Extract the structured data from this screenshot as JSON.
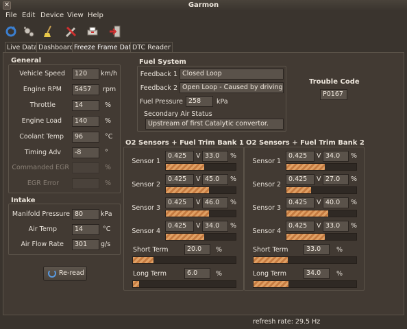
{
  "window": {
    "title": "Garmon",
    "close_icon": "close-icon"
  },
  "menu": [
    "File",
    "Edit",
    "Device",
    "View",
    "Help"
  ],
  "toolbar": [
    "refresh-icon",
    "device-settings-icon",
    "clear-codes-icon",
    "tools-icon",
    "print-icon",
    "exit-icon"
  ],
  "tabs": [
    "Live Data",
    "Dashboard",
    "Freeze Frame Data",
    "DTC Reader"
  ],
  "general": {
    "title": "General",
    "rows": [
      {
        "label": "Vehicle Speed",
        "value": "120",
        "unit": "km/h",
        "enabled": true
      },
      {
        "label": "Engine RPM",
        "value": "5457",
        "unit": "rpm",
        "enabled": true
      },
      {
        "label": "Throttle",
        "value": "14",
        "unit": "%",
        "enabled": true
      },
      {
        "label": "Engine Load",
        "value": "140",
        "unit": "%",
        "enabled": true
      },
      {
        "label": "Coolant Temp",
        "value": "96",
        "unit": "°C",
        "enabled": true
      },
      {
        "label": "Timing Adv",
        "value": "-8",
        "unit": "°",
        "enabled": true
      },
      {
        "label": "Commanded EGR",
        "value": "",
        "unit": "%",
        "enabled": false
      },
      {
        "label": "EGR Error",
        "value": "",
        "unit": "%",
        "enabled": false
      }
    ]
  },
  "intake": {
    "title": "Intake",
    "rows": [
      {
        "label": "Manifold Pressure",
        "value": "80",
        "unit": "kPa"
      },
      {
        "label": "Air Temp",
        "value": "14",
        "unit": "°C"
      },
      {
        "label": "Air Flow Rate",
        "value": "301",
        "unit": "g/s"
      }
    ]
  },
  "reread_label": "Re-read",
  "fuel": {
    "title": "Fuel System",
    "feedback1_label": "Feedback 1",
    "feedback1_value": "Closed Loop",
    "feedback2_label": "Feedback 2",
    "feedback2_value": "Open Loop - Caused by driving con",
    "pressure_label": "Fuel Pressure",
    "pressure_value": "258",
    "pressure_unit": "kPa",
    "secondary_label": "Secondary Air Status",
    "secondary_value": "Upstream of first Catalytic convertor."
  },
  "trouble": {
    "label": "Trouble Code",
    "value": "P0167"
  },
  "bank1": {
    "title": "O2 Sensors + Fuel Trim Bank 1",
    "sensors": [
      {
        "label": "Sensor 1",
        "volts": "0.425",
        "v_unit": "V",
        "trim": "33.0",
        "t_unit": "%",
        "fill": 0.55
      },
      {
        "label": "Sensor 2",
        "volts": "0.425",
        "v_unit": "V",
        "trim": "45.0",
        "t_unit": "%",
        "fill": 0.62
      },
      {
        "label": "Sensor 3",
        "volts": "0.425",
        "v_unit": "V",
        "trim": "46.0",
        "t_unit": "%",
        "fill": 0.62
      },
      {
        "label": "Sensor 4",
        "volts": "0.425",
        "v_unit": "V",
        "trim": "34.0",
        "t_unit": "%",
        "fill": 0.55
      }
    ],
    "short_label": "Short Term",
    "short_value": "20.0",
    "short_unit": "%",
    "short_fill": 0.2,
    "long_label": "Long Term",
    "long_value": "6.0",
    "long_unit": "%",
    "long_fill": 0.06
  },
  "bank2": {
    "title": "O2 Sensors + Fuel Trim Bank 2",
    "sensors": [
      {
        "label": "Sensor 1",
        "volts": "0.425",
        "v_unit": "V",
        "trim": "34.0",
        "t_unit": "%",
        "fill": 0.55
      },
      {
        "label": "Sensor 2",
        "volts": "0.425",
        "v_unit": "V",
        "trim": "27.0",
        "t_unit": "%",
        "fill": 0.35
      },
      {
        "label": "Sensor 3",
        "volts": "0.425",
        "v_unit": "V",
        "trim": "40.0",
        "t_unit": "%",
        "fill": 0.6
      },
      {
        "label": "Sensor 4",
        "volts": "0.425",
        "v_unit": "V",
        "trim": "33.0",
        "t_unit": "%",
        "fill": 0.55
      }
    ],
    "short_label": "Short Term",
    "short_value": "33.0",
    "short_unit": "%",
    "short_fill": 0.33,
    "long_label": "Long Term",
    "long_value": "34.0",
    "long_unit": "%",
    "long_fill": 0.34
  },
  "status": {
    "refresh": "refresh rate: 29.5 Hz"
  },
  "colors": {
    "accent": "#e0a064",
    "background": "#3a342e",
    "panel": "#423a33"
  }
}
